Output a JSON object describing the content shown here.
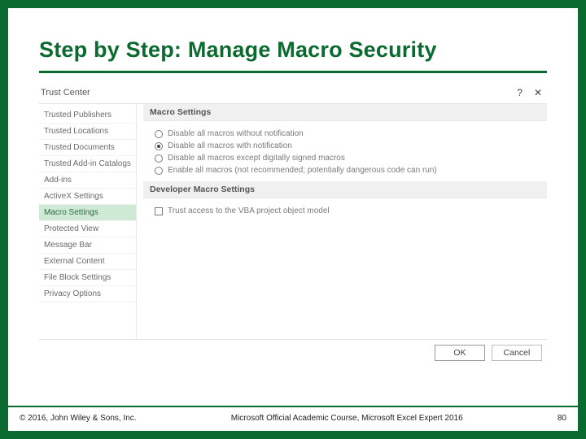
{
  "slide": {
    "title": "Step by Step: Manage Macro Security"
  },
  "trustCenter": {
    "windowTitle": "Trust Center",
    "sidebar": {
      "items": [
        {
          "label": "Trusted Publishers"
        },
        {
          "label": "Trusted Locations"
        },
        {
          "label": "Trusted Documents"
        },
        {
          "label": "Trusted Add-in Catalogs"
        },
        {
          "label": "Add-ins"
        },
        {
          "label": "ActiveX Settings"
        },
        {
          "label": "Macro Settings"
        },
        {
          "label": "Protected View"
        },
        {
          "label": "Message Bar"
        },
        {
          "label": "External Content"
        },
        {
          "label": "File Block Settings"
        },
        {
          "label": "Privacy Options"
        }
      ],
      "selectedIndex": 6
    },
    "sections": {
      "macroSettings": {
        "header": "Macro Settings",
        "options": [
          {
            "label": "Disable all macros without notification",
            "checked": false
          },
          {
            "label": "Disable all macros with notification",
            "checked": true
          },
          {
            "label": "Disable all macros except digitally signed macros",
            "checked": false
          },
          {
            "label": "Enable all macros (not recommended; potentially dangerous code can run)",
            "checked": false
          }
        ]
      },
      "developerMacroSettings": {
        "header": "Developer Macro Settings",
        "checkbox": {
          "label": "Trust access to the VBA project object model",
          "checked": false
        }
      }
    },
    "buttons": {
      "ok": "OK",
      "cancel": "Cancel"
    }
  },
  "footer": {
    "left": "© 2016, John Wiley & Sons, Inc.",
    "center": "Microsoft Official Academic Course, Microsoft Excel Expert 2016",
    "right": "80"
  }
}
